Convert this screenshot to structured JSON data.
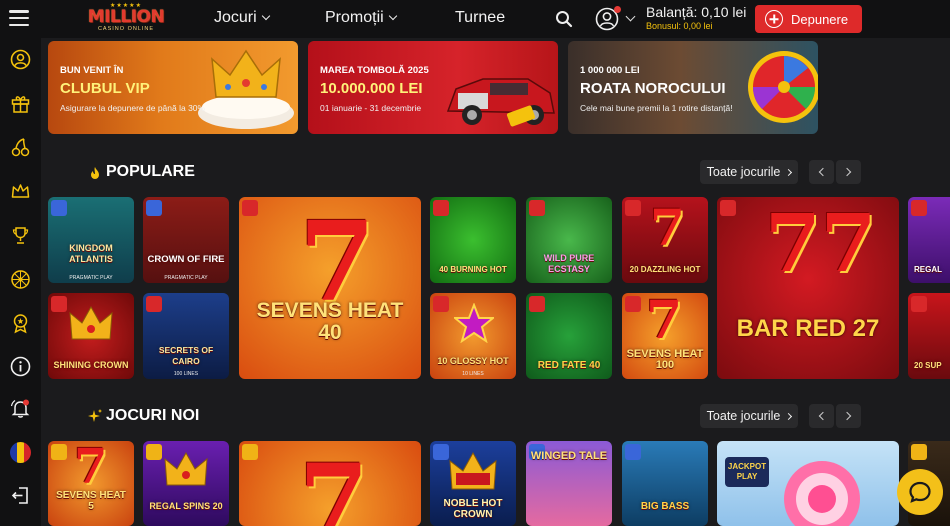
{
  "header": {
    "logo": {
      "word": "MILLION",
      "sub": "CASINO ONLINE"
    },
    "nav": [
      {
        "label": "Jocuri",
        "has_dropdown": true
      },
      {
        "label": "Promoții",
        "has_dropdown": true
      },
      {
        "label": "Turnee",
        "has_dropdown": false
      }
    ],
    "balance_label": "Balanță: 0,10 lei",
    "bonus_label": "Bonusul: 0,00 lei",
    "deposit_label": "Depunere"
  },
  "sidebar": {
    "icons": [
      "user-circle-icon",
      "gift-icon",
      "cherries-icon",
      "crown-icon",
      "trophy-icon",
      "wheel-icon",
      "award-icon",
      "info-icon",
      "bell-alert-icon",
      "romania-flag-icon",
      "logout-icon"
    ]
  },
  "banners": [
    {
      "line1": "BUN VENIT ÎN",
      "line2": "CLUBUL VIP",
      "line3": "Asigurare la depunere de până la 30%"
    },
    {
      "line1": "MAREA TOMBOLĂ 2025",
      "line2": "10.000.000 LEI",
      "line3": "01 ianuarie - 31 decembrie"
    },
    {
      "line1": "1 000 000 LEI",
      "line2": "ROATA NOROCULUI",
      "line3": "Cele mai bune premii la 1 rotire distanță!"
    }
  ],
  "sections": {
    "popular": {
      "title": "POPULARE",
      "all_label": "Toate jocurile"
    },
    "new": {
      "title": "JOCURI NOI",
      "all_label": "Toate jocurile"
    }
  },
  "popular_games": [
    {
      "name": "KINGDOM ATLANTIS",
      "provider": "PRAGMATIC PLAY",
      "badge": "jackpot"
    },
    {
      "name": "CROWN OF FIRE",
      "provider": "PRAGMATIC PLAY",
      "badge": "jackpot"
    },
    {
      "name": "SEVENS HEAT 40",
      "provider": "",
      "badge": "hot"
    },
    {
      "name": "40 BURNING HOT",
      "provider": "",
      "badge": "hot"
    },
    {
      "name": "WILD PURE ECSTASY",
      "provider": "",
      "badge": "hot"
    },
    {
      "name": "20 DAZZLING HOT",
      "provider": "",
      "badge": "hot"
    },
    {
      "name": "BAR RED 27",
      "provider": "",
      "badge": "hot"
    },
    {
      "name": "REGAL",
      "provider": "",
      "badge": "hot"
    },
    {
      "name": "SHINING CROWN",
      "provider": "",
      "badge": "hot"
    },
    {
      "name": "SECRETS OF CAIRO",
      "provider": "100 LINES",
      "badge": "hot"
    },
    {
      "name": "10 GLOSSY HOT",
      "provider": "10 LINES",
      "badge": "hot"
    },
    {
      "name": "RED FATE 40",
      "provider": "",
      "badge": "hot"
    },
    {
      "name": "SEVENS HEAT 100",
      "provider": "",
      "badge": "hot"
    },
    {
      "name": "20 SUP",
      "provider": "",
      "badge": "hot"
    }
  ],
  "new_games": [
    {
      "name": "SEVENS HEAT 5",
      "badge": "new"
    },
    {
      "name": "REGAL SPINS 20",
      "badge": "new"
    },
    {
      "name": "",
      "badge": "new"
    },
    {
      "name": "NOBLE HOT CROWN",
      "badge": "jackpot"
    },
    {
      "name": "WINGED TALE",
      "badge": "jackpot"
    },
    {
      "name": "BIG BASS",
      "badge": "jackpot"
    },
    {
      "name": "JACKPOT PLAY",
      "badge": "jackpot"
    },
    {
      "name": "",
      "badge": "new"
    }
  ],
  "colors": {
    "accent_red": "#de2a2a",
    "accent_yellow": "#f4c20d",
    "background": "#1b1b1d",
    "sidebar": "#111112"
  }
}
